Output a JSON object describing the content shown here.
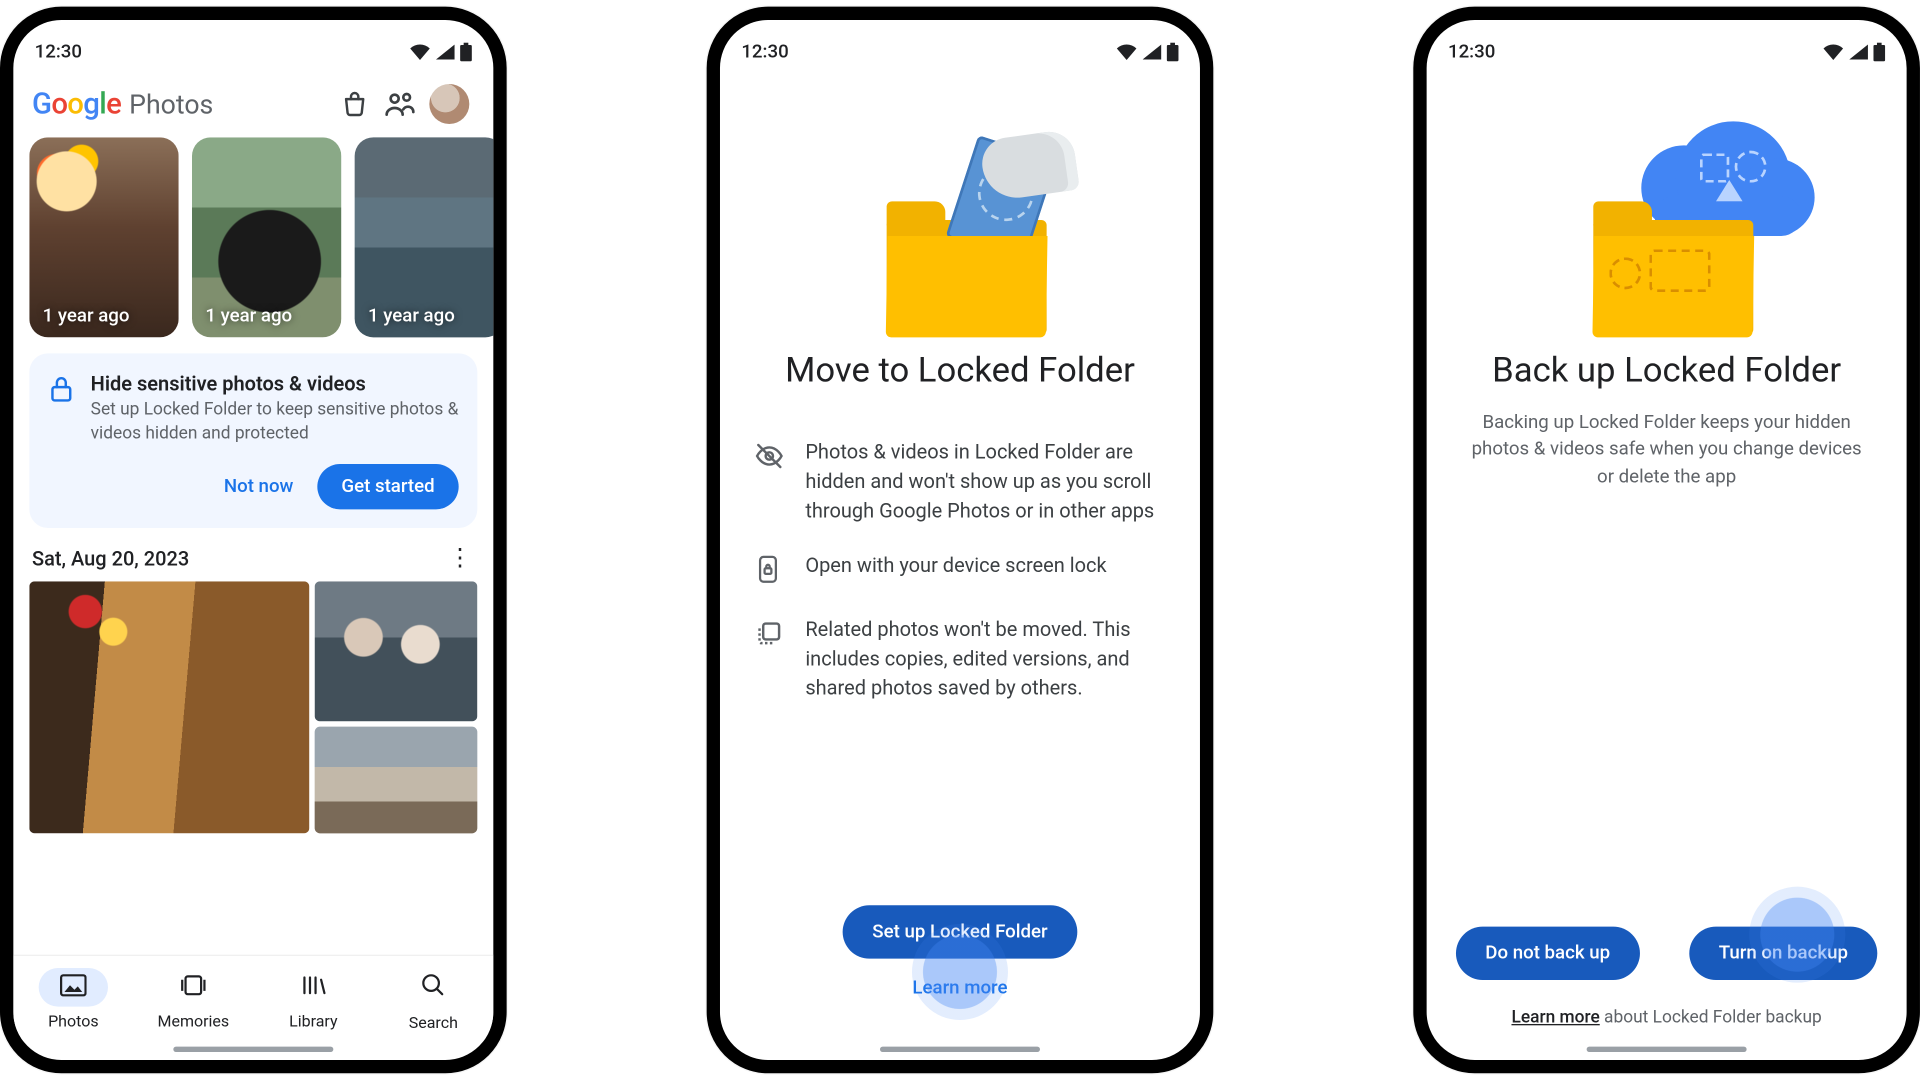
{
  "status": {
    "time": "12:30"
  },
  "phone1": {
    "logo_word": "Photos",
    "memories": [
      {
        "label": "1 year ago"
      },
      {
        "label": "1 year ago"
      },
      {
        "label": "1 year ago"
      }
    ],
    "promo": {
      "title": "Hide sensitive photos & videos",
      "body": "Set up Locked Folder to keep sensitive photos & videos hidden and protected",
      "not_now": "Not now",
      "get_started": "Get started"
    },
    "date_header": "Sat, Aug 20, 2023",
    "nav": {
      "photos": "Photos",
      "memories": "Memories",
      "library": "Library",
      "search": "Search"
    }
  },
  "phone2": {
    "title": "Move to Locked Folder",
    "bullets": [
      "Photos & videos in Locked Folder are hidden and won't show up as you scroll through Google Photos or in other apps",
      "Open with your device screen lock",
      "Related photos won't be moved. This includes copies, edited versions, and shared photos saved by others."
    ],
    "cta": "Set up Locked Folder",
    "learn_more": "Learn more"
  },
  "phone3": {
    "title": "Back up Locked Folder",
    "body": "Backing up Locked Folder keeps your hidden photos & videos safe when you change devices or delete the app",
    "secondary": "Do not back up",
    "primary": "Turn on backup",
    "footer_link": "Learn more",
    "footer_rest": " about Locked Folder backup"
  }
}
